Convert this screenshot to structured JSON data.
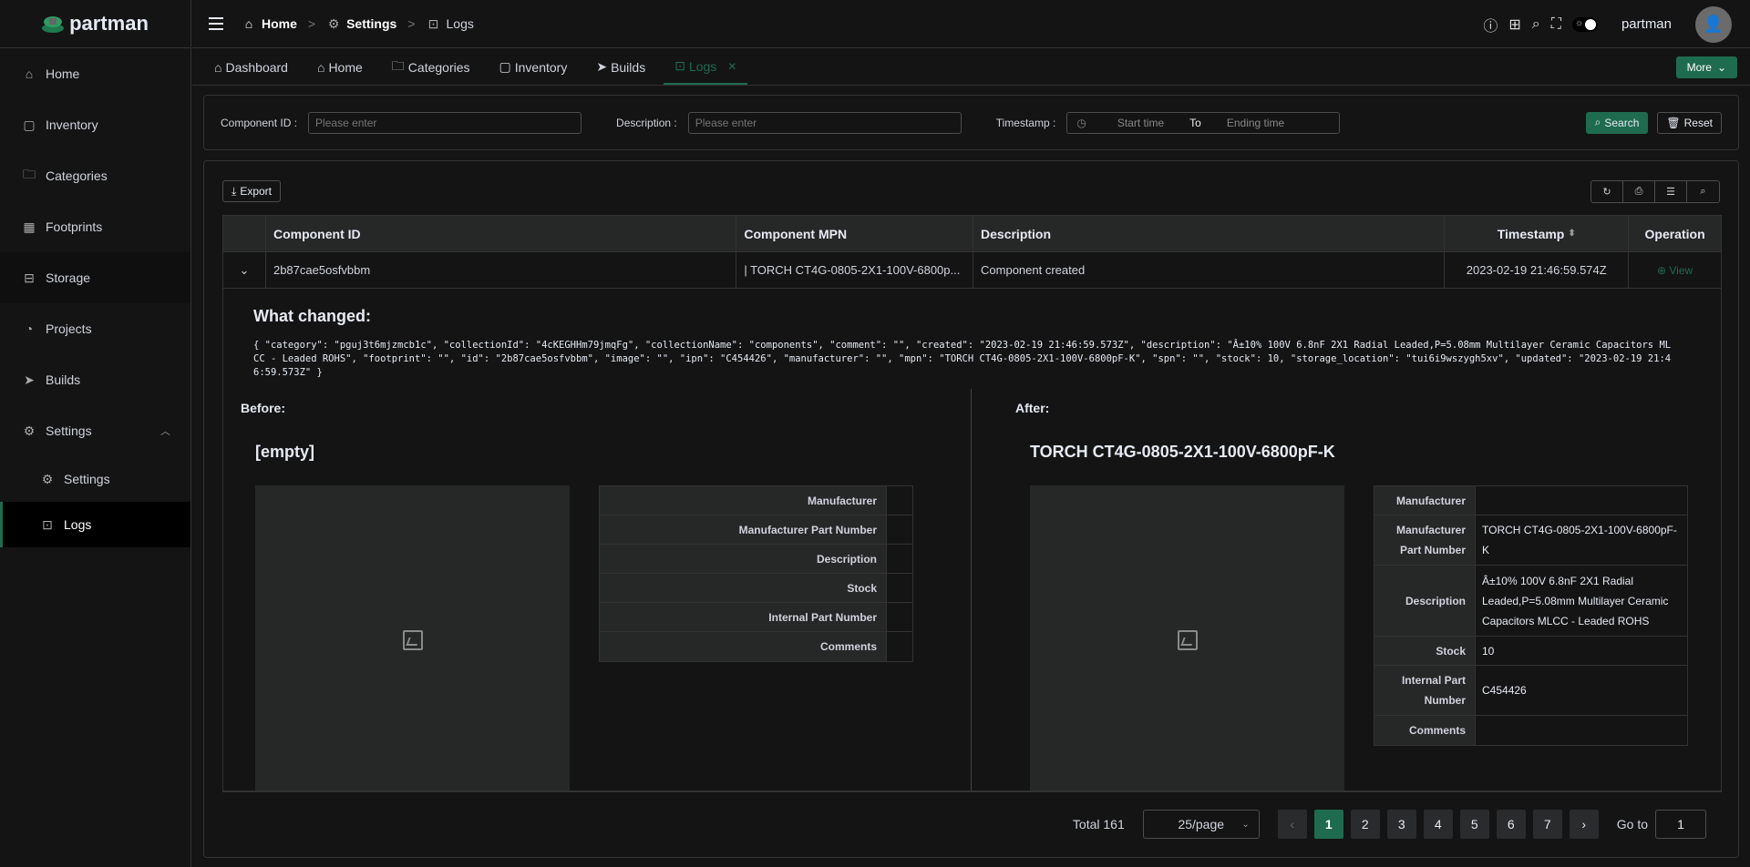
{
  "app": {
    "name": "partman"
  },
  "sidebar": {
    "items": [
      {
        "label": "Home",
        "icon": "home-icon"
      },
      {
        "label": "Inventory",
        "icon": "chip-icon"
      },
      {
        "label": "Categories",
        "icon": "folder-icon"
      },
      {
        "label": "Footprints",
        "icon": "grid-icon"
      },
      {
        "label": "Storage",
        "icon": "box-icon"
      },
      {
        "label": "Projects",
        "icon": "gauge-icon"
      },
      {
        "label": "Builds",
        "icon": "send-icon"
      },
      {
        "label": "Settings",
        "icon": "gear-icon",
        "expanded": true
      }
    ],
    "sub_items": [
      {
        "label": "Settings",
        "icon": "gear-icon"
      },
      {
        "label": "Logs",
        "icon": "presentation-icon",
        "active": true
      }
    ]
  },
  "breadcrumb": [
    "Home",
    "Settings",
    "Logs"
  ],
  "header": {
    "username": "partman"
  },
  "tabs": [
    {
      "label": "Dashboard",
      "icon": "home-icon"
    },
    {
      "label": "Home",
      "icon": "home-icon"
    },
    {
      "label": "Categories",
      "icon": "folder-icon"
    },
    {
      "label": "Inventory",
      "icon": "chip-icon"
    },
    {
      "label": "Builds",
      "icon": "send-icon"
    },
    {
      "label": "Logs",
      "icon": "presentation-icon",
      "active": true
    }
  ],
  "more_label": "More",
  "filters": {
    "component_id_label": "Component ID :",
    "component_id_placeholder": "Please enter",
    "description_label": "Description :",
    "description_placeholder": "Please enter",
    "timestamp_label": "Timestamp :",
    "start_placeholder": "Start time",
    "to_label": "To",
    "end_placeholder": "Ending time",
    "search_label": "Search",
    "reset_label": "Reset"
  },
  "toolbar": {
    "export_label": "Export"
  },
  "table": {
    "columns": [
      "Component ID",
      "Component MPN",
      "Description",
      "Timestamp",
      "Operation"
    ],
    "rows": [
      {
        "component_id": "2b87cae5osfvbbm",
        "mpn": "| TORCH CT4G-0805-2X1-100V-6800p...",
        "description": "Component created",
        "timestamp": "2023-02-19 21:46:59.574Z",
        "operation": "View"
      }
    ]
  },
  "detail": {
    "what_changed_title": "What changed:",
    "json_text": "{ \"category\": \"pguj3t6mjzmcb1c\", \"collectionId\": \"4cKEGHHm79jmqFg\", \"collectionName\": \"components\", \"comment\": \"\", \"created\": \"2023-02-19 21:46:59.573Z\", \"description\": \"Â±10% 100V 6.8nF 2X1 Radial Leaded,P=5.08mm Multilayer Ceramic Capacitors MLCC - Leaded ROHS\", \"footprint\": \"\", \"id\": \"2b87cae5osfvbbm\", \"image\": \"\", \"ipn\": \"C454426\", \"manufacturer\": \"\", \"mpn\": \"TORCH CT4G-0805-2X1-100V-6800pF-K\", \"spn\": \"\", \"stock\": 10, \"storage_location\": \"tui6i9wszygh5xv\", \"updated\": \"2023-02-19 21:46:59.573Z\" }",
    "before": {
      "label": "Before:",
      "title": "[empty]",
      "fields": [
        {
          "key": "Manufacturer",
          "value": ""
        },
        {
          "key": "Manufacturer Part Number",
          "value": ""
        },
        {
          "key": "Description",
          "value": ""
        },
        {
          "key": "Stock",
          "value": ""
        },
        {
          "key": "Internal Part Number",
          "value": ""
        },
        {
          "key": "Comments",
          "value": ""
        }
      ]
    },
    "after": {
      "label": "After:",
      "title": "TORCH CT4G-0805-2X1-100V-6800pF-K",
      "fields": [
        {
          "key": "Manufacturer",
          "value": ""
        },
        {
          "key": "Manufacturer Part Number",
          "value": "TORCH CT4G-0805-2X1-100V-6800pF-K"
        },
        {
          "key": "Description",
          "value": "Â±10% 100V 6.8nF 2X1 Radial Leaded,P=5.08mm Multilayer Ceramic Capacitors MLCC - Leaded ROHS"
        },
        {
          "key": "Stock",
          "value": "10"
        },
        {
          "key": "Internal Part Number",
          "value": "C454426"
        },
        {
          "key": "Comments",
          "value": ""
        }
      ]
    }
  },
  "pagination": {
    "total_label": "Total 161",
    "page_size": "25/page",
    "pages": [
      "1",
      "2",
      "3",
      "4",
      "5",
      "6",
      "7"
    ],
    "current": "1",
    "goto_label": "Go to",
    "goto_value": "1"
  },
  "colors": {
    "accent": "#1f6b4f",
    "background": "#141414",
    "panel": "#262727"
  }
}
